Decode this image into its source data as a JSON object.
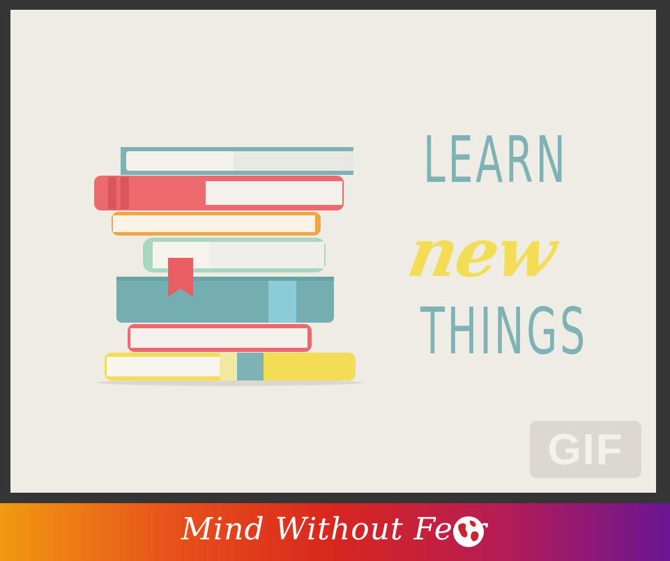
{
  "graphic": {
    "line1": "LEARN",
    "line2": "new",
    "line3": "THINGS",
    "badge": "GIF"
  },
  "footer": {
    "text": "Mind Without Fear",
    "icon": "globe-icon"
  },
  "colors": {
    "background": "#efece6",
    "frame": "#353535",
    "teal": "#7fb2b5",
    "yellow": "#f4dd56",
    "red": "#ec6a6e"
  }
}
